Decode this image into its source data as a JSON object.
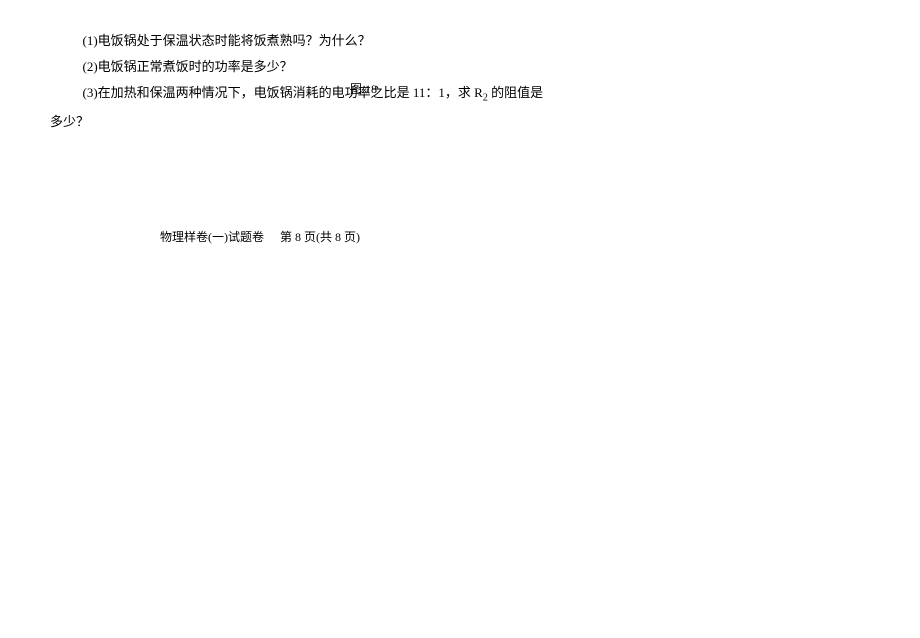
{
  "questions": {
    "q1": "(1)电饭锅处于保温状态时能将饭煮熟吗？为什么？",
    "q2": "(2)电饭锅正常煮饭时的功率是多少？",
    "q3_part1": "(3)在加热和保温两种情况下，电饭锅消耗的电功率之比是 11：1，求 R",
    "q3_sub": "2",
    "q3_part2": " 的阻值是",
    "q3_cont": "多少？"
  },
  "figure_caption": "图 18",
  "footer": {
    "left": "物理样卷(一)试题卷",
    "right": "第 8 页(共 8 页)"
  }
}
